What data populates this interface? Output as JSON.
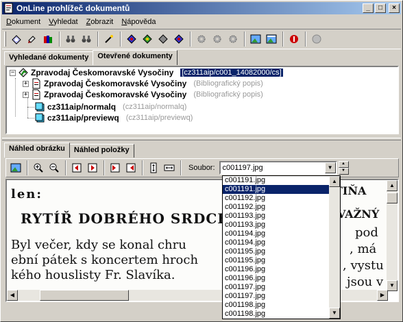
{
  "window": {
    "title": "OnLine prohlížeč dokumentů",
    "controls": {
      "minimize": "_",
      "maximize": "□",
      "close": "×"
    }
  },
  "menu": [
    {
      "label": "Dokument",
      "u": "D",
      "rest": "okument"
    },
    {
      "label": "Vyhledat",
      "u": "V",
      "rest": "yhledat"
    },
    {
      "label": "Zobrazit",
      "u": "Z",
      "rest": "obrazit"
    },
    {
      "label": "Nápověda",
      "u": "N",
      "rest": "ápověda"
    }
  ],
  "top_tabs": {
    "search_results": "Vyhledané dokumenty",
    "open_documents": "Otevřené dokumenty"
  },
  "tree": {
    "root": {
      "label": "Zpravodaj Českomoravské Vysočiny",
      "path": "[cz311aip/c001_14082000/cs]"
    },
    "children": [
      {
        "label": "Zpravodaj Českomoravské Vysočiny",
        "note": "(Bibliografický popis)"
      },
      {
        "label": "Zpravodaj Českomoravské Vysočiny",
        "note": "(Bibliografický popis)"
      },
      {
        "label": "cz311aip/normalq",
        "note": "(cz311aip/normalq)"
      },
      {
        "label": "cz311aip/previewq",
        "note": "(cz311aip/previewq)"
      }
    ]
  },
  "bottom_tabs": {
    "image_preview": "Náhled obrázku",
    "item_preview": "Náhled položky"
  },
  "file_selector": {
    "label": "Soubor:",
    "value": "c001197.jpg"
  },
  "dropdown": {
    "selected_index": 1,
    "items": [
      "c001191.jpg",
      "c001191.jpg",
      "c001192.jpg",
      "c001192.jpg",
      "c001193.jpg",
      "c001193.jpg",
      "c001194.jpg",
      "c001194.jpg",
      "c001195.jpg",
      "c001195.jpg",
      "c001196.jpg",
      "c001196.jpg",
      "c001197.jpg",
      "c001197.jpg",
      "c001198.jpg",
      "c001198.jpg"
    ]
  },
  "scan_text": {
    "line1": "len:",
    "heading": "RYTÍŘ DOBRÉHO SRDCE.",
    "body1": "Byl večer, kdy se konal chru",
    "body2": "ební pátek s koncertem hroch",
    "body3": "kého houslisty Fr. Slavíka.",
    "right1": "TIŇA",
    "right2": "VAŽNÝ",
    "right3": "pod",
    "right4": ", má",
    "right5": ", vystu",
    "right6": "jsou v"
  },
  "colors": {
    "titlebar_start": "#0a246a",
    "titlebar_end": "#a6caf0",
    "selection": "#0a246a",
    "face": "#d4d0c8"
  }
}
